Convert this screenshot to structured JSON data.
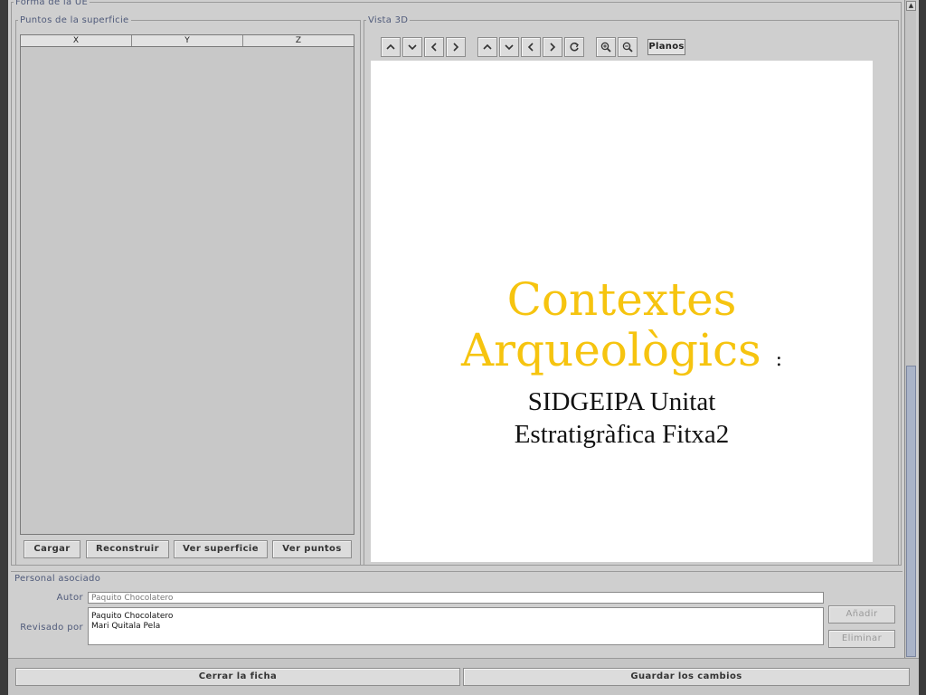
{
  "forma": {
    "legend": "Forma de la UE",
    "puntos": {
      "legend": "Puntos de la superficie",
      "columns": [
        "X",
        "Y",
        "Z"
      ],
      "buttons": {
        "cargar": "Cargar",
        "reconstruir": "Reconstruir",
        "ver_superficie": "Ver superficie",
        "ver_puntos": "Ver puntos"
      }
    },
    "vista": {
      "legend": "Vista 3D",
      "toolbar_icons": [
        "rotate-up-icon",
        "rotate-down-icon",
        "rotate-left-icon",
        "rotate-right-icon",
        "move-up-icon",
        "move-down-icon",
        "move-left-icon",
        "move-right-icon",
        "reset-view-icon",
        "zoom-in-icon",
        "zoom-out-icon"
      ],
      "planos_label": "Planos",
      "overlay": {
        "line1": "Contextes",
        "line2": "Arqueològics",
        "colon": ":",
        "line3": "SIDGEIPA Unitat",
        "line4": "Estratigràfica Fitxa2"
      }
    }
  },
  "personal": {
    "legend": "Personal asociado",
    "autor_label": "Autor",
    "autor_value": "Paquito Chocolatero",
    "revisado_label": "Revisado por",
    "revisado_items": [
      "Paquito Chocolatero",
      "Mari Quitala Pela"
    ],
    "anadir": "Añadir",
    "eliminar": "Eliminar"
  },
  "footer": {
    "cerrar": "Cerrar la ficha",
    "guardar": "Guardar los cambios"
  },
  "colors": {
    "accent_label": "#4f5a7a",
    "title_yellow": "#f6c40f",
    "panel_bg": "#cfcfcf"
  }
}
